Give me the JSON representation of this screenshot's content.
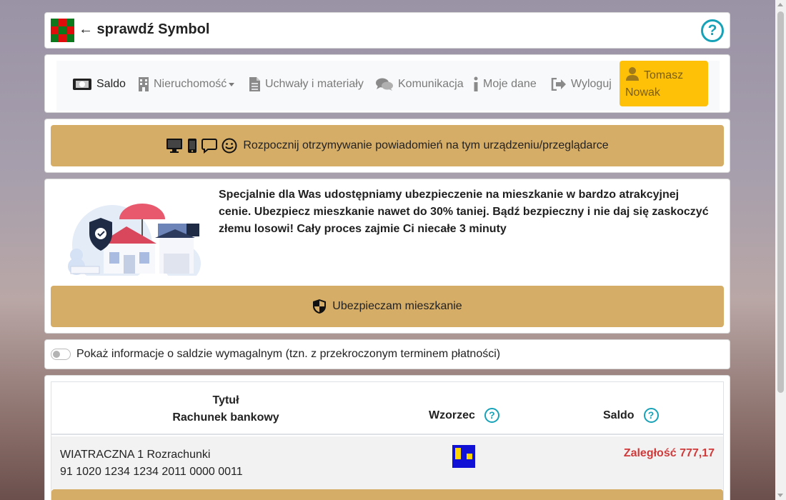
{
  "header": {
    "title": "← sprawdź Symbol",
    "help_icon": "question-circle-icon"
  },
  "nav": {
    "items": [
      {
        "label": "Saldo",
        "icon": "money-bill-icon"
      },
      {
        "label": "Nieruchomość",
        "icon": "building-icon"
      },
      {
        "label": "Uchwały i materiały",
        "icon": "file-icon"
      },
      {
        "label": "Komunikacja",
        "icon": "comments-icon"
      },
      {
        "label": "Moje dane",
        "icon": "info-icon"
      },
      {
        "label": "Wyloguj",
        "icon": "sign-out-icon"
      }
    ],
    "user": {
      "line1": "Tomasz",
      "line2": "Nowak",
      "icon": "user-icon"
    }
  },
  "notifications": {
    "label": "Rozpocznij otrzymywanie powiadomień na tym urządzeniu/przeglądarce"
  },
  "insurance": {
    "text": "Specjalnie dla Was udostępniamy ubezpieczenie na mieszkanie w bardzo atrakcyjnej cenie. Ubezpiecz mieszkanie nawet do 30% taniej. Bądź bezpieczny i nie daj się zaskoczyć złemu losowi! Cały proces zajmie Ci niecałe 3 minuty",
    "button_label": "Ubezpieczam mieszkanie"
  },
  "toggle": {
    "label": "Pokaż informacje o saldzie wymagalnym (tzn. z przekroczonym terminem płatności)",
    "checked": false
  },
  "table": {
    "headers": {
      "tytul": "Tytuł",
      "rachunek": "Rachunek bankowy",
      "wzorzec": "Wzorzec",
      "saldo": "Saldo"
    },
    "rows": [
      {
        "name": "WIATRACZNA 1 Rozrachunki",
        "account": "91 1020 1234 1234 2011 0000 0011",
        "saldo": "Zaległość 777,17"
      }
    ]
  },
  "colors": {
    "gold": "#d6ad66",
    "accent_help": "#17a2b8",
    "user_button": "#ffc107",
    "debt": "#d13a3a"
  }
}
